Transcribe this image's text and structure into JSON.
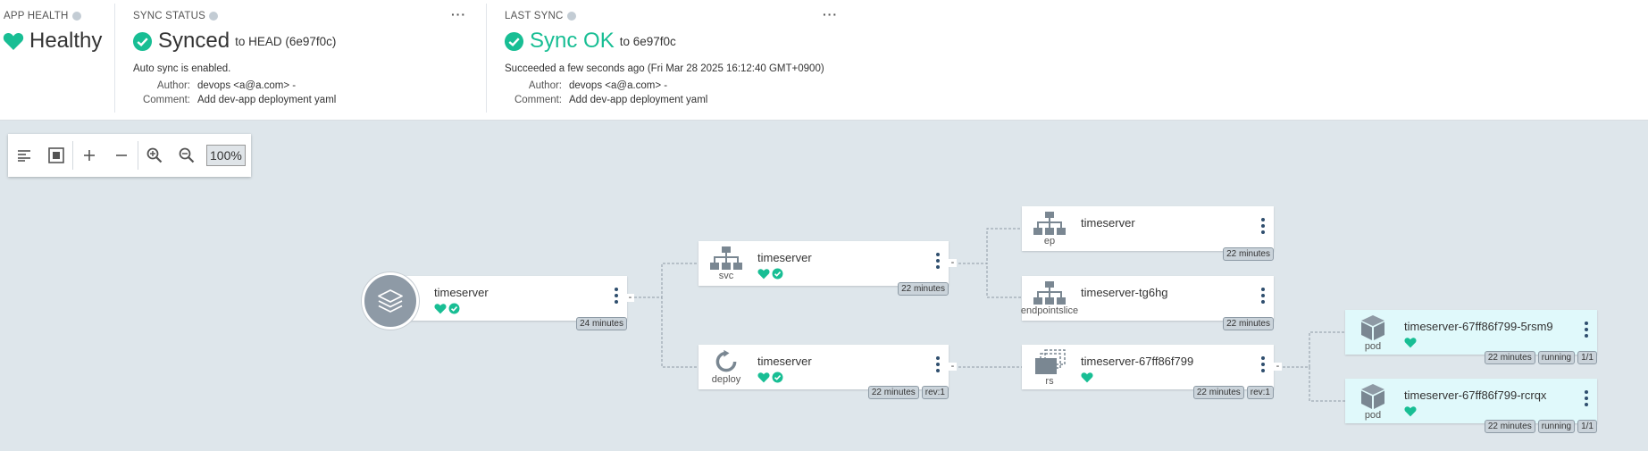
{
  "app_health": {
    "title": "APP HEALTH",
    "status": "Healthy"
  },
  "sync_status": {
    "title": "SYNC STATUS",
    "status": "Synced",
    "target": "to HEAD (6e97f0c)",
    "auto": "Auto sync is enabled.",
    "author_label": "Author:",
    "author": "devops <a@a.com> -",
    "comment_label": "Comment:",
    "comment": "Add dev-app deployment yaml"
  },
  "last_sync": {
    "title": "LAST SYNC",
    "status": "Sync OK",
    "target": "to 6e97f0c",
    "detail": "Succeeded a few seconds ago (Fri Mar 28 2025 16:12:40 GMT+0900)",
    "author_label": "Author:",
    "author": "devops <a@a.com> -",
    "comment_label": "Comment:",
    "comment": "Add dev-app deployment yaml"
  },
  "toolbar": {
    "zoom": "100%"
  },
  "colors": {
    "healthy": "#18be94",
    "tag_bg": "#cad3da",
    "canvas": "#dee6eb",
    "pod_bg": "#e0f9fb"
  },
  "nodes": {
    "app": {
      "name": "timeserver",
      "age": "24 minutes"
    },
    "svc": {
      "name": "timeserver",
      "kind": "svc",
      "age": "22 minutes"
    },
    "deploy": {
      "name": "timeserver",
      "kind": "deploy",
      "age": "22 minutes",
      "rev": "rev:1"
    },
    "ep": {
      "name": "timeserver",
      "kind": "ep",
      "age": "22 minutes"
    },
    "endpointslice": {
      "name": "timeserver-tg6hg",
      "kind": "endpointslice",
      "age": "22 minutes"
    },
    "rs": {
      "name": "timeserver-67ff86f799",
      "kind": "rs",
      "age": "22 minutes",
      "rev": "rev:1"
    },
    "pod1": {
      "name": "timeserver-67ff86f799-5rsm9",
      "kind": "pod",
      "age": "22 minutes",
      "state": "running",
      "ready": "1/1"
    },
    "pod2": {
      "name": "timeserver-67ff86f799-rcrqx",
      "kind": "pod",
      "age": "22 minutes",
      "state": "running",
      "ready": "1/1"
    }
  }
}
